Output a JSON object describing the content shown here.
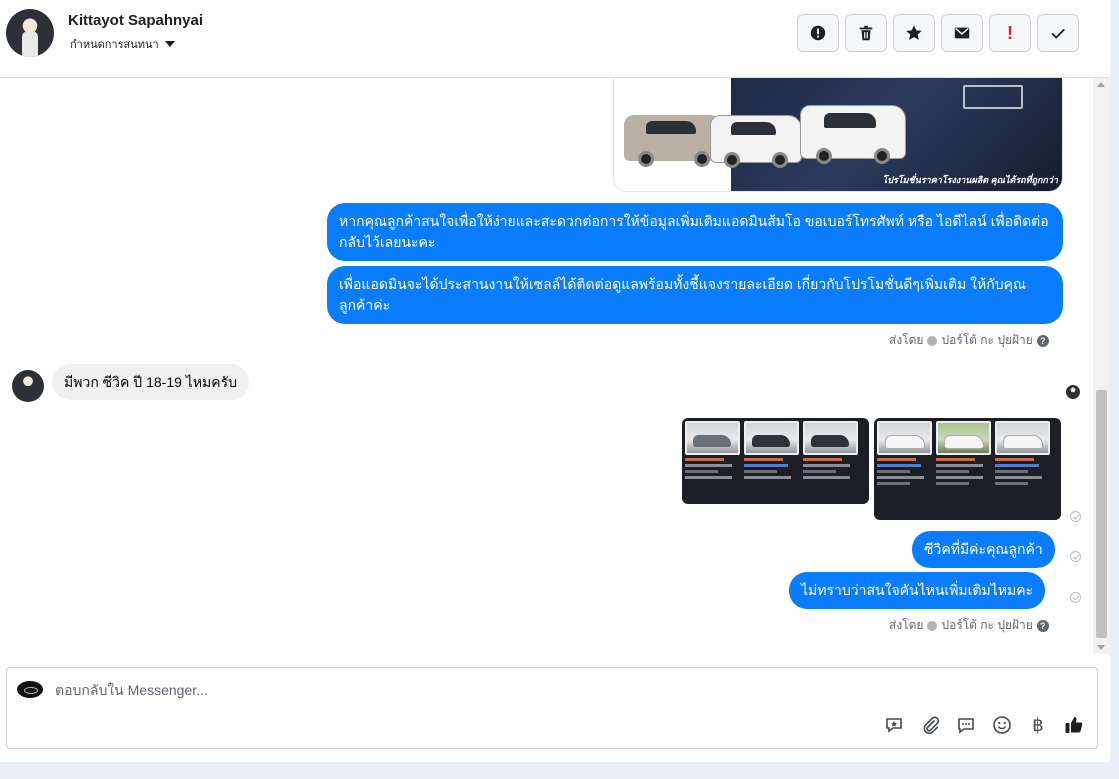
{
  "header": {
    "name": "Kittayot Sapahnyai",
    "subtitle": "กำหนดการสนทนา",
    "toolbar_icons": [
      "alert-circle-icon",
      "trash-icon",
      "star-icon",
      "envelope-icon",
      "exclamation-icon",
      "check-icon"
    ],
    "toolbar_red_label": "!"
  },
  "thread": {
    "promo_caption": "โปรโมชั่นราคาโรงงานผลิต คุณได้รถที่ถูกกว่า",
    "msg_out_1": "หากคุณลูกค้าสนใจเพื่อให้ง่ายและสะดวกต่อการให้ข้อมูลเพิ่มเติมแอดมินส้มโอ ขอเบอร์โทรศัพท์ หรือ ไอดีไลน์ เพื่อติดต่อกลับไว้เลยนะคะ",
    "msg_out_2": "เพื่อแอดมินจะได้ประสานงานให้เซลล์ได้ติดต่อดูแลพร้อมทั้งชี้แจงรายละเอียด เกี่ยวกับโปรโมชั่นดีๆเพิ่มเติม ให้กับคุณลูกค้าค่ะ",
    "sent_by_1": {
      "prefix": "ส่งโดย",
      "name": "ปอร์โต้ กะ ปุยฝ้าย",
      "help": "?"
    },
    "msg_in_1": "มีพวก ซีวิค ปี 18-19 ไหมครับ",
    "msg_out_3": "ซีวิคที่มีค่ะคุณลูกค้า",
    "msg_out_4": "ไม่ทราบว่าสนใจคันไหนเพิ่มเติมไหมคะ",
    "sent_by_2": {
      "prefix": "ส่งโดย",
      "name": "ปอร์โต้ กะ ปุยฝ้าย",
      "help": "?"
    }
  },
  "composer": {
    "placeholder": "ตอบกลับใน Messenger...",
    "tool_icons": [
      "saved-reply-icon",
      "attachment-icon",
      "chat-bubble-icon",
      "emoji-icon",
      "baht-icon",
      "thumbs-up-icon"
    ],
    "baht_symbol": "฿",
    "like_color": "#1c1e21"
  },
  "colors": {
    "outgoing_bubble": "#0a7cff",
    "incoming_bubble": "#f0f0f0",
    "alert_red": "#e41e3f"
  }
}
